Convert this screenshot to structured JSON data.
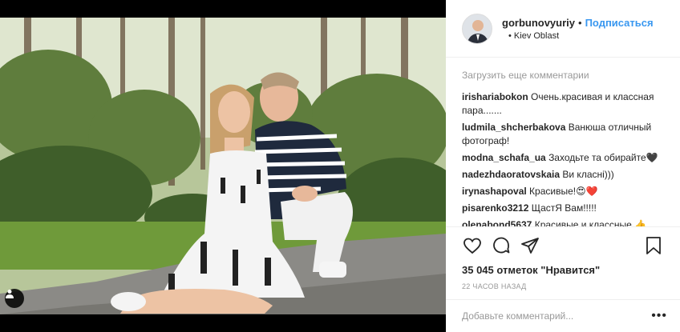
{
  "photo": {
    "alt": "",
    "tag_icon": "user-icon"
  },
  "header": {
    "username": "gorbunovyuriy",
    "dot": "•",
    "follow_label": "Подписаться",
    "location_dot": "•",
    "location": "Kiev Oblast"
  },
  "comments": {
    "load_more": "Загрузить еще комментарии",
    "items": [
      {
        "user": "irishariabokon",
        "text": "Очень.красивая и классная пара......."
      },
      {
        "user": "ludmila_shcherbakova",
        "text": "Ванюша отличный фотограф!"
      },
      {
        "user": "modna_schafa_ua",
        "text": "Заходьте та обирайте🖤"
      },
      {
        "user": "nadezhdaoratovskaia",
        "text": "Ви класні)))"
      },
      {
        "user": "irynashapoval",
        "text": "Красивые!😍❤️"
      },
      {
        "user": "pisarenko3212",
        "text": "ЩастЯ Вам!!!!!"
      },
      {
        "user": "olenabond5637",
        "text": "Красивые и классные 👍"
      }
    ]
  },
  "actions": {
    "icons": [
      "heart-icon",
      "comment-icon",
      "share-icon",
      "bookmark-icon"
    ],
    "likes": "35 045 отметок \"Нравится\"",
    "time_ago": "22 ЧАСОВ НАЗАД"
  },
  "add_comment": {
    "placeholder": "Добавьте комментарий...",
    "more": "•••"
  },
  "colors": {
    "link": "#3897f0",
    "text": "#262626",
    "muted": "#999999",
    "border": "#efefef"
  }
}
